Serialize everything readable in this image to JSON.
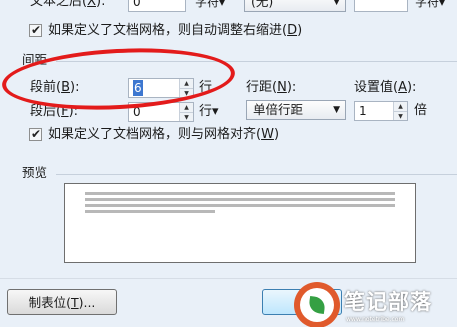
{
  "top_row": {
    "label_text": "文本之后",
    "label_hotkey": "X",
    "label_suffix": "):",
    "value": "0",
    "unit": "字符▾",
    "dropdown_value": "(无)",
    "unit2": "字符▾"
  },
  "indent_checkbox": {
    "text": "如果定义了文档网格，则自动调整右缩进(",
    "hotkey": "D",
    "suffix": ")"
  },
  "spacing": {
    "section_title": "间距",
    "before": {
      "label": "段前(",
      "hotkey": "B",
      "suffix": "):",
      "value": "6",
      "unit": "行"
    },
    "after": {
      "label": "段后(",
      "hotkey": "F",
      "suffix": "):",
      "value": "0",
      "unit": "行▾"
    },
    "line_spacing": {
      "label": "行距(",
      "hotkey": "N",
      "suffix": "):",
      "value": "单倍行距"
    },
    "setting": {
      "label": "设置值(",
      "hotkey": "A",
      "suffix": "):",
      "value": "1",
      "unit": "倍"
    }
  },
  "grid_checkbox": {
    "text": "如果定义了文档网格，则与网格对齐(",
    "hotkey": "W",
    "suffix": ")"
  },
  "preview": {
    "title": "预览"
  },
  "tabs_button": {
    "label": "制表位(",
    "hotkey": "T",
    "suffix": ")..."
  },
  "watermark": {
    "name": "笔记部落",
    "url": "www.notetribe.com"
  },
  "colors": {
    "annotation": "#e31b1b",
    "dialog_bg": "#e9f0f8",
    "watermark": "#e05a2c"
  }
}
